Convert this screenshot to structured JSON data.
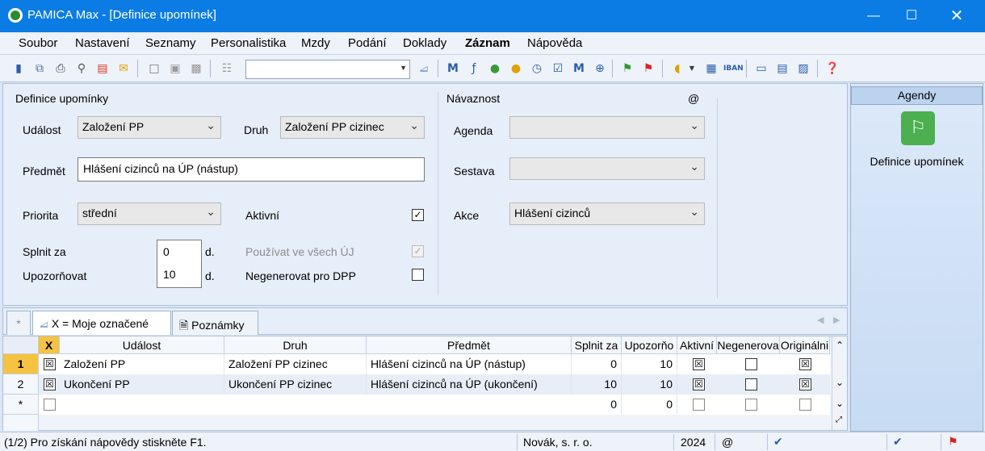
{
  "window": {
    "title": "PAMICA Max - [Definice upomínek]"
  },
  "menu": [
    "Soubor",
    "Nastavení",
    "Seznamy",
    "Personalistika",
    "Mzdy",
    "Podání",
    "Doklady",
    "Záznam",
    "Nápověda"
  ],
  "form": {
    "definice_title": "Definice upomínky",
    "udalost_label": "Událost",
    "udalost_value": "Založení PP",
    "druh_label": "Druh",
    "druh_value": "Založení PP cizinec",
    "predmet_label": "Předmět",
    "predmet_value": "Hlášení cizinců na ÚP (nástup)",
    "priorita_label": "Priorita",
    "priorita_value": "střední",
    "aktivni_label": "Aktivní",
    "splnit_label": "Splnit za",
    "splnit_value": "0",
    "upozornovat_label": "Upozorňovat",
    "upozornovat_value": "10",
    "unit_d": "d.",
    "pouzivat_label": "Používat ve všech ÚJ",
    "negenerovat_label": "Negenerovat pro DPP",
    "navaznost_title": "Návaznost",
    "at_sign": "@",
    "agenda_label": "Agenda",
    "sestava_label": "Sestava",
    "akce_label": "Akce",
    "akce_value": "Hlášení cizinců"
  },
  "tabs": {
    "star": "*",
    "moje": "X = Moje označené",
    "poznamky": "Poznámky"
  },
  "grid": {
    "headers": [
      "X",
      "Událost",
      "Druh",
      "Předmět",
      "Splnit za",
      "Upozorňo",
      "Aktivní",
      "Negenerova",
      "Originálni"
    ],
    "rows": [
      {
        "num": "1",
        "udalost": "Založení PP",
        "druh": "Založení PP cizinec",
        "predmet": "Hlášení cizinců na ÚP (nástup)",
        "splnit": "0",
        "upoz": "10",
        "x": true,
        "aktivni": true,
        "neg": false,
        "orig": true
      },
      {
        "num": "2",
        "udalost": "Ukončení PP",
        "druh": "Ukončení PP cizinec",
        "predmet": "Hlášení cizinců na ÚP (ukončení)",
        "splnit": "10",
        "upoz": "10",
        "x": true,
        "aktivni": true,
        "neg": false,
        "orig": true
      },
      {
        "num": "*",
        "udalost": "",
        "druh": "",
        "predmet": "",
        "splnit": "0",
        "upoz": "0",
        "x": false,
        "aktivni": false,
        "neg": false,
        "orig": false
      }
    ]
  },
  "agendy": {
    "header": "Agendy",
    "item": "Definice upomínek"
  },
  "status": {
    "help": "(1/2) Pro získání nápovědy stiskněte F1.",
    "company": "Novák, s. r. o.",
    "year": "2024",
    "at": "@"
  }
}
